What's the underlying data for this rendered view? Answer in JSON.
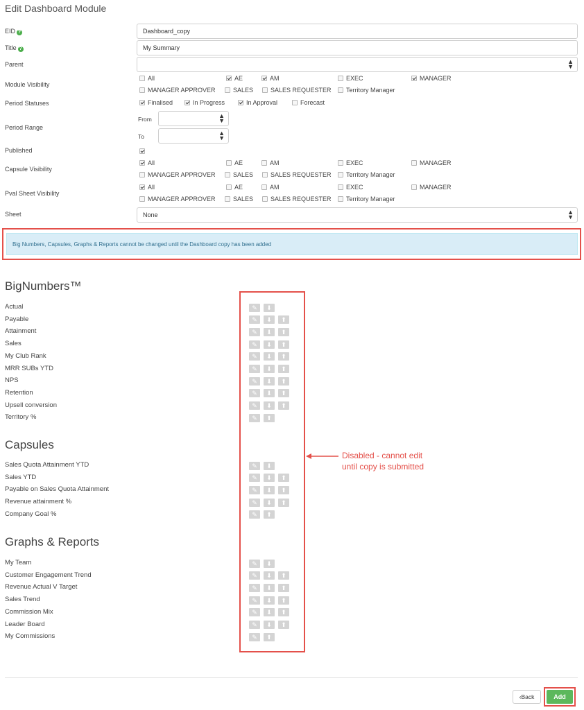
{
  "page_title": "Edit Dashboard Module",
  "form": {
    "eid": {
      "label": "EID",
      "value": "Dashboard_copy"
    },
    "title": {
      "label": "Title",
      "value": "My Summary"
    },
    "parent": {
      "label": "Parent",
      "value": ""
    },
    "module_visibility": {
      "label": "Module Visibility",
      "options": [
        {
          "label": "All",
          "checked": false
        },
        {
          "label": "AE",
          "checked": true
        },
        {
          "label": "AM",
          "checked": true
        },
        {
          "label": "EXEC",
          "checked": false
        },
        {
          "label": "MANAGER",
          "checked": true
        },
        {
          "label": "MANAGER APPROVER",
          "checked": false
        },
        {
          "label": "SALES",
          "checked": false
        },
        {
          "label": "SALES REQUESTER",
          "checked": false
        },
        {
          "label": "Territory Manager",
          "checked": false
        }
      ]
    },
    "period_statuses": {
      "label": "Period Statuses",
      "options": [
        {
          "label": "Finalised",
          "checked": true
        },
        {
          "label": "In Progress",
          "checked": true
        },
        {
          "label": "In Approval",
          "checked": true
        },
        {
          "label": "Forecast",
          "checked": false
        }
      ]
    },
    "period_range": {
      "label": "Period Range",
      "from_label": "From",
      "to_label": "To",
      "from_value": "",
      "to_value": ""
    },
    "published": {
      "label": "Published",
      "checked": true
    },
    "capsule_visibility": {
      "label": "Capsule Visibility",
      "options": [
        {
          "label": "All",
          "checked": true
        },
        {
          "label": "AE",
          "checked": false
        },
        {
          "label": "AM",
          "checked": false
        },
        {
          "label": "EXEC",
          "checked": false
        },
        {
          "label": "MANAGER",
          "checked": false
        },
        {
          "label": "MANAGER APPROVER",
          "checked": false
        },
        {
          "label": "SALES",
          "checked": false
        },
        {
          "label": "SALES REQUESTER",
          "checked": false
        },
        {
          "label": "Territory Manager",
          "checked": false
        }
      ]
    },
    "pval_sheet_visibility": {
      "label": "Pval Sheet Visibility",
      "options": [
        {
          "label": "All",
          "checked": true
        },
        {
          "label": "AE",
          "checked": false
        },
        {
          "label": "AM",
          "checked": false
        },
        {
          "label": "EXEC",
          "checked": false
        },
        {
          "label": "MANAGER",
          "checked": false
        },
        {
          "label": "MANAGER APPROVER",
          "checked": false
        },
        {
          "label": "SALES",
          "checked": false
        },
        {
          "label": "SALES REQUESTER",
          "checked": false
        },
        {
          "label": "Territory Manager",
          "checked": false
        }
      ]
    },
    "sheet": {
      "label": "Sheet",
      "value": "None"
    }
  },
  "alert": "Big Numbers, Capsules, Graphs & Reports cannot be changed until the Dashboard copy has been added",
  "sections": [
    {
      "title": "BigNumbers™",
      "items": [
        {
          "label": "Actual",
          "buttons": [
            "edit",
            "down"
          ]
        },
        {
          "label": "Payable",
          "buttons": [
            "edit",
            "down",
            "up"
          ]
        },
        {
          "label": "Attainment",
          "buttons": [
            "edit",
            "down",
            "up"
          ]
        },
        {
          "label": "Sales",
          "buttons": [
            "edit",
            "down",
            "up"
          ]
        },
        {
          "label": "My Club Rank",
          "buttons": [
            "edit",
            "down",
            "up"
          ]
        },
        {
          "label": "MRR SUBs YTD",
          "buttons": [
            "edit",
            "down",
            "up"
          ]
        },
        {
          "label": "NPS",
          "buttons": [
            "edit",
            "down",
            "up"
          ]
        },
        {
          "label": "Retention",
          "buttons": [
            "edit",
            "down",
            "up"
          ]
        },
        {
          "label": "Upsell conversion",
          "buttons": [
            "edit",
            "down",
            "up"
          ]
        },
        {
          "label": "Territory %",
          "buttons": [
            "edit",
            "up"
          ]
        }
      ]
    },
    {
      "title": "Capsules",
      "items": [
        {
          "label": "Sales Quota Attainment YTD",
          "buttons": [
            "edit",
            "down"
          ]
        },
        {
          "label": "Sales YTD",
          "buttons": [
            "edit",
            "down",
            "up"
          ]
        },
        {
          "label": "Payable on Sales Quota Attainment",
          "buttons": [
            "edit",
            "down",
            "up"
          ]
        },
        {
          "label": "Revenue attainment %",
          "buttons": [
            "edit",
            "down",
            "up"
          ]
        },
        {
          "label": "Company Goal %",
          "buttons": [
            "edit",
            "up"
          ]
        }
      ]
    },
    {
      "title": "Graphs & Reports",
      "items": [
        {
          "label": "My Team",
          "buttons": [
            "edit",
            "down"
          ]
        },
        {
          "label": "Customer Engagement Trend",
          "buttons": [
            "edit",
            "down",
            "up"
          ]
        },
        {
          "label": "Revenue Actual V Target",
          "buttons": [
            "edit",
            "down",
            "up"
          ]
        },
        {
          "label": "Sales Trend",
          "buttons": [
            "edit",
            "down",
            "up"
          ]
        },
        {
          "label": "Commission Mix",
          "buttons": [
            "edit",
            "down",
            "up"
          ]
        },
        {
          "label": "Leader Board",
          "buttons": [
            "edit",
            "down",
            "up"
          ]
        },
        {
          "label": "My Commissions",
          "buttons": [
            "edit",
            "up"
          ]
        }
      ]
    }
  ],
  "annotation": {
    "line1": "Disabled - cannot edit",
    "line2": "until copy is submitted",
    "color": "#e4504a"
  },
  "footer": {
    "back_label": "‹Back",
    "add_label": "Add"
  },
  "colors": {
    "accent_green": "#5cb85c",
    "alert_bg": "#d9edf7",
    "alert_text": "#31708f",
    "highlight_red": "#e4504a",
    "disabled_btn": "#d4d4d4"
  }
}
